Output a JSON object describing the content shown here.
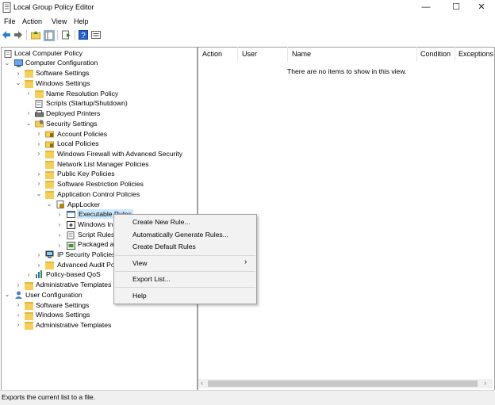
{
  "window": {
    "title": "Local Group Policy Editor"
  },
  "menubar": [
    "File",
    "Action",
    "View",
    "Help"
  ],
  "tree": {
    "root": "Local Computer Policy",
    "computer_configuration": "Computer Configuration",
    "software_settings": "Software Settings",
    "windows_settings": "Windows Settings",
    "name_resolution_policy": "Name Resolution Policy",
    "scripts": "Scripts (Startup/Shutdown)",
    "deployed_printers": "Deployed Printers",
    "security_settings": "Security Settings",
    "account_policies": "Account Policies",
    "local_policies": "Local Policies",
    "windows_firewall": "Windows Firewall with Advanced Security",
    "network_list": "Network List Manager Policies",
    "public_key": "Public Key Policies",
    "software_restriction": "Software Restriction Policies",
    "application_control": "Application Control Policies",
    "applocker": "AppLocker",
    "executable_rules": "Executable Rules",
    "windows_installer": "Windows In",
    "script_rules": "Script Rules",
    "packaged": "Packaged a",
    "ip_security": "IP Security Policies",
    "advanced_audit": "Advanced Audit Po",
    "policy_qos": "Policy-based QoS",
    "admin_templates": "Administrative Templates",
    "user_configuration": "User Configuration",
    "user_software_settings": "Software Settings",
    "user_windows_settings": "Windows Settings",
    "user_admin_templates": "Administrative Templates"
  },
  "list": {
    "columns": [
      "Action",
      "User",
      "Name",
      "Condition",
      "Exceptions"
    ],
    "empty_message": "There are no items to show in this view."
  },
  "context_menu": {
    "create_new_rule": "Create New Rule...",
    "auto_generate": "Automatically Generate Rules...",
    "create_default": "Create Default Rules",
    "view": "View",
    "export_list": "Export List...",
    "help": "Help"
  },
  "status": "Exports the current list to a file."
}
